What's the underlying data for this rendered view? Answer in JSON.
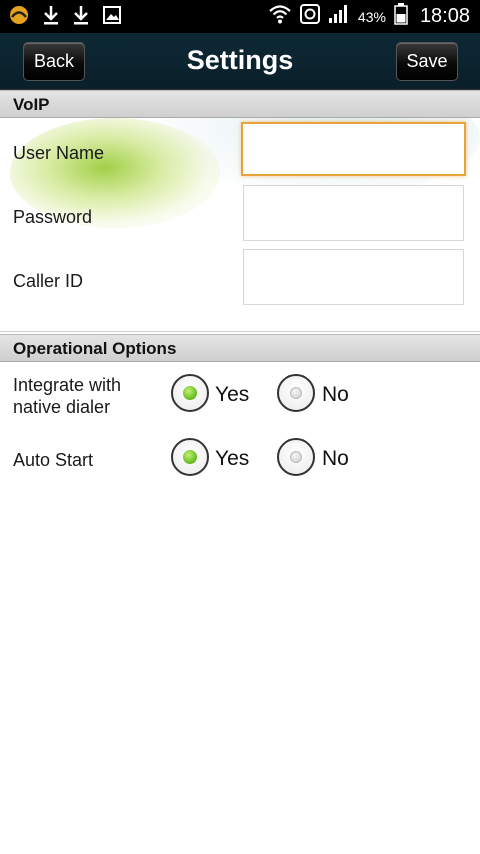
{
  "status_bar": {
    "battery": "43%",
    "clock": "18:08",
    "icons": [
      "app-notification-icon",
      "download-icon",
      "download-icon",
      "image-icon",
      "wifi-icon",
      "sync-icon",
      "signal-icon",
      "battery-icon"
    ]
  },
  "header": {
    "back_label": "Back",
    "title": "Settings",
    "save_label": "Save"
  },
  "voip": {
    "section_title": "VoIP",
    "fields": [
      {
        "label": "User Name",
        "value": ""
      },
      {
        "label": "Password",
        "value": ""
      },
      {
        "label": "Caller ID",
        "value": ""
      }
    ]
  },
  "options": {
    "section_title": "Operational Options",
    "groups": [
      {
        "label_line1": "Integrate with",
        "label_line2": "native dialer",
        "yes": "Yes",
        "no": "No",
        "selected": "Yes"
      },
      {
        "label_line1": "Auto Start",
        "label_line2": "",
        "yes": "Yes",
        "no": "No",
        "selected": "Yes"
      }
    ]
  },
  "colors": {
    "accent_green": "#6fc12a",
    "focus_orange": "#e8a33a",
    "header_bg": "#0d2935"
  }
}
